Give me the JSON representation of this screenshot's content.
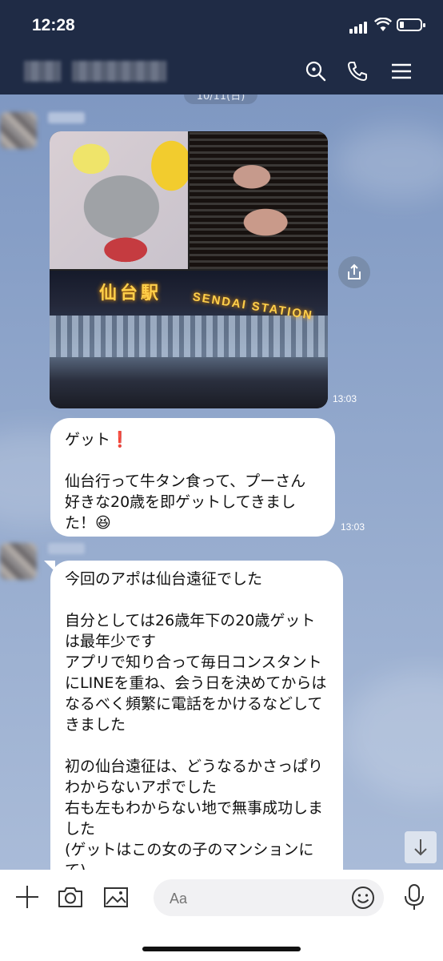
{
  "status": {
    "time": "12:28"
  },
  "chat": {
    "date_label": "10/11(日)",
    "photo_message": {
      "station_sign": "仙台駅",
      "station_sign_en": "SENDAI STATION",
      "time": "13:03"
    },
    "message1": {
      "text": "ゲット❗️\n\n仙台行って牛タン食って、プーさん好きな20歳を即ゲットしてきました！😆",
      "time": "13:03"
    },
    "message2": {
      "text": "今回のアポは仙台遠征でした\n\n自分としては26歳年下の20歳ゲットは最年少です\nアプリで知り合って毎日コンスタントにLINEを重ね、会う日を決めてからはなるべく頻繁に電話をかけるなどしてきました\n\n初の仙台遠征は、どうなるかさっぱりわからないアポでした\n右も左もわからない地で無事成功しました\n(ゲットはこの女の子のマンションにて)"
    }
  },
  "input": {
    "placeholder": "Aa"
  },
  "icons": [
    "search-icon",
    "phone-icon",
    "menu-icon",
    "share-icon",
    "arrow-down-icon",
    "plus-icon",
    "camera-icon",
    "image-icon",
    "emoji-icon",
    "mic-icon"
  ]
}
